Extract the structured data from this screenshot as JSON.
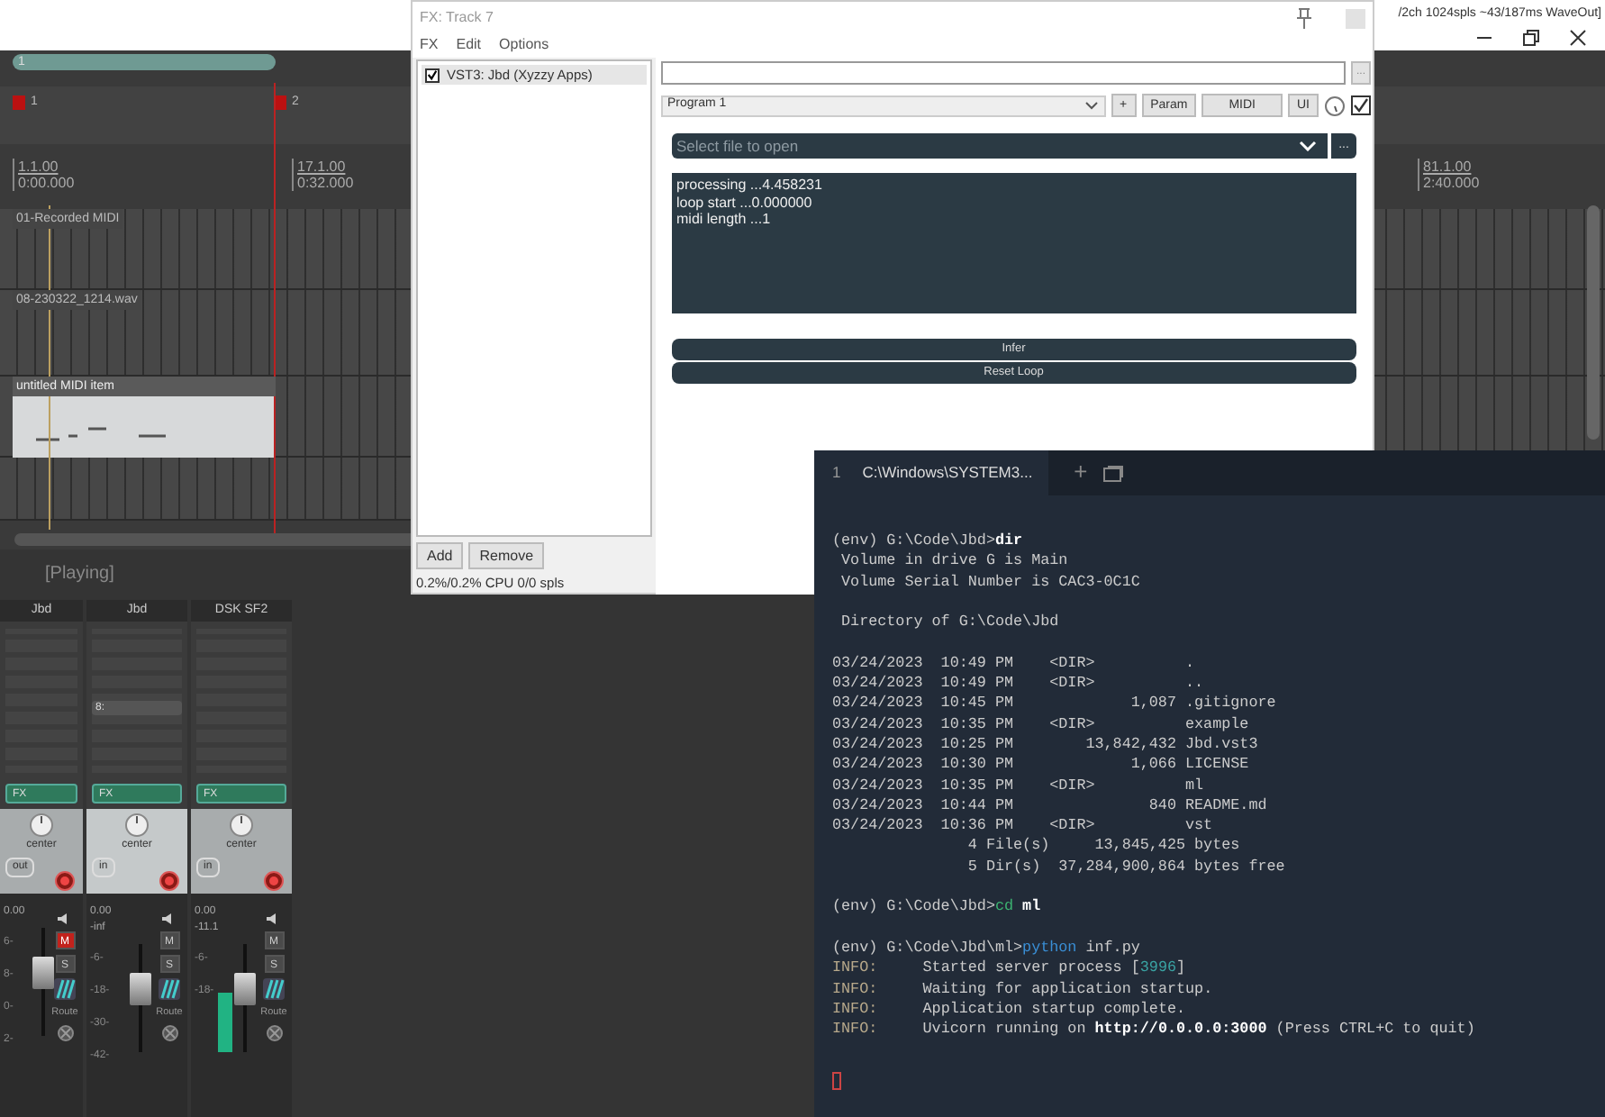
{
  "daw": {
    "title": "/2ch 1024spls ~43/187ms WaveOut]",
    "region": {
      "label": "1"
    },
    "markers": [
      {
        "label": "1"
      },
      {
        "label": "2"
      }
    ],
    "ruler": [
      {
        "bar": "1.1.00",
        "time": "0:00.000"
      },
      {
        "bar": "17.1.00",
        "time": "0:32.000"
      },
      {
        "bar": "81.1.00",
        "time": "2:40.000"
      }
    ],
    "tracks": [
      {
        "item": "01-Recorded MIDI",
        "kind": "dim"
      },
      {
        "item": "08-230322_1214.wav",
        "kind": "dim"
      },
      {
        "item": "untitled MIDI item",
        "kind": "midi"
      }
    ],
    "transport_status": "[Playing]",
    "mixer": [
      {
        "name": "Jbd",
        "selected": false,
        "fx": "FX",
        "pan": "center",
        "input": "out",
        "volume": "0.00",
        "muted": true,
        "mute": "M",
        "solo": "S",
        "route": "Route",
        "scale": [
          "6-",
          "8-",
          "0-",
          "2-"
        ],
        "fader": {
          "level": 0.62
        }
      },
      {
        "name": "Jbd",
        "selected": true,
        "send": "8:",
        "fx": "FX",
        "pan": "center",
        "input": "in",
        "volume": "0.00",
        "peak": "-inf",
        "muted": false,
        "mute": "M",
        "solo": "S",
        "route": "Route",
        "scale": [
          "-6-",
          "-18-",
          "-30-",
          "-42-"
        ],
        "fader": {
          "level": 0.62
        }
      },
      {
        "name": "DSK SF2",
        "selected": false,
        "fx": "FX",
        "pan": "center",
        "input": "in",
        "volume": "0.00",
        "peak": "-11.1",
        "muted": false,
        "mute": "M",
        "solo": "S",
        "route": "Route",
        "scale": [
          "-6-",
          "-18-"
        ],
        "fader": {
          "level": 0.62
        },
        "meter": {
          "level": 0.55
        }
      }
    ]
  },
  "fx_window": {
    "title": "FX: Track 7",
    "menu": [
      "FX",
      "Edit",
      "Options"
    ],
    "fx_list": [
      {
        "label": "VST3: Jbd (Xyzzy Apps)",
        "checked": true,
        "selected": true
      }
    ],
    "buttons": [
      "Add",
      "Remove"
    ],
    "cpu": "0.2%/0.2% CPU 0/0 spls",
    "browse": "...",
    "preset": "Program 1",
    "tool_buttons": [
      "+",
      "Param",
      "MIDI",
      "UI"
    ],
    "enabled": true,
    "plugin": {
      "file_placeholder": "Select file to open",
      "browse": "...",
      "log": [
        "processing ...4.458231",
        "loop start ...0.000000",
        "midi length ...1"
      ],
      "buttons": [
        "Infer",
        "Reset Loop"
      ]
    }
  },
  "terminal": {
    "tab": {
      "index": "1",
      "title": "C:\\Windows\\SYSTEM3...",
      "selected": true
    },
    "new_tab": "+",
    "blocks": [
      {
        "lines": [
          [
            {
              "text": "(env) G:\\Code\\Jbd>",
              "kind": "plain"
            },
            {
              "text": "dir",
              "kind": "command"
            }
          ],
          [
            {
              "text": " Volume in drive G is Main",
              "kind": "plain"
            }
          ],
          [
            {
              "text": " Volume Serial Number is CAC3-0C1C",
              "kind": "plain"
            }
          ]
        ]
      },
      {
        "lines": [
          [
            {
              "text": " Directory of G:\\Code\\Jbd",
              "kind": "plain"
            }
          ]
        ]
      },
      {
        "lines": [
          [
            {
              "text": "03/24/2023  10:49 PM    <DIR>          .",
              "kind": "plain"
            }
          ],
          [
            {
              "text": "03/24/2023  10:49 PM    <DIR>          ..",
              "kind": "plain"
            }
          ],
          [
            {
              "text": "03/24/2023  10:45 PM             1,087 .gitignore",
              "kind": "plain"
            }
          ],
          [
            {
              "text": "03/24/2023  10:35 PM    <DIR>          example",
              "kind": "plain"
            }
          ],
          [
            {
              "text": "03/24/2023  10:25 PM        13,842,432 Jbd.vst3",
              "kind": "plain"
            }
          ],
          [
            {
              "text": "03/24/2023  10:30 PM             1,066 LICENSE",
              "kind": "plain"
            }
          ],
          [
            {
              "text": "03/24/2023  10:35 PM    <DIR>          ml",
              "kind": "plain"
            }
          ],
          [
            {
              "text": "03/24/2023  10:44 PM               840 README.md",
              "kind": "plain"
            }
          ],
          [
            {
              "text": "03/24/2023  10:36 PM    <DIR>          vst",
              "kind": "plain"
            }
          ],
          [
            {
              "text": "               4 File(s)     13,845,425 bytes",
              "kind": "plain"
            }
          ],
          [
            {
              "text": "               5 Dir(s)  37,284,900,864 bytes free",
              "kind": "plain"
            }
          ]
        ]
      },
      {
        "lines": [
          [
            {
              "text": "(env) G:\\Code\\Jbd>",
              "kind": "plain"
            },
            {
              "text": "cd",
              "kind": "green"
            },
            {
              "text": " ml",
              "kind": "command"
            }
          ]
        ]
      },
      {
        "lines": [
          [
            {
              "text": "(env) G:\\Code\\Jbd\\ml>",
              "kind": "plain"
            },
            {
              "text": "python",
              "kind": "blue"
            },
            {
              "text": " inf.py",
              "kind": "plain"
            }
          ],
          [
            {
              "text": "INFO:",
              "kind": "info"
            },
            {
              "text": "     Started server process [",
              "kind": "plain"
            },
            {
              "text": "3996",
              "kind": "number"
            },
            {
              "text": "]",
              "kind": "plain"
            }
          ],
          [
            {
              "text": "INFO:",
              "kind": "info"
            },
            {
              "text": "     Waiting for application startup.",
              "kind": "plain"
            }
          ],
          [
            {
              "text": "INFO:",
              "kind": "info"
            },
            {
              "text": "     Application startup complete.",
              "kind": "plain"
            }
          ],
          [
            {
              "text": "INFO:",
              "kind": "info"
            },
            {
              "text": "     Uvicorn running on ",
              "kind": "plain"
            },
            {
              "text": "http://0.0.0.0:3000",
              "kind": "command"
            },
            {
              "text": " (Press CTRL+C to quit)",
              "kind": "plain"
            }
          ]
        ]
      }
    ],
    "cursor": true
  }
}
